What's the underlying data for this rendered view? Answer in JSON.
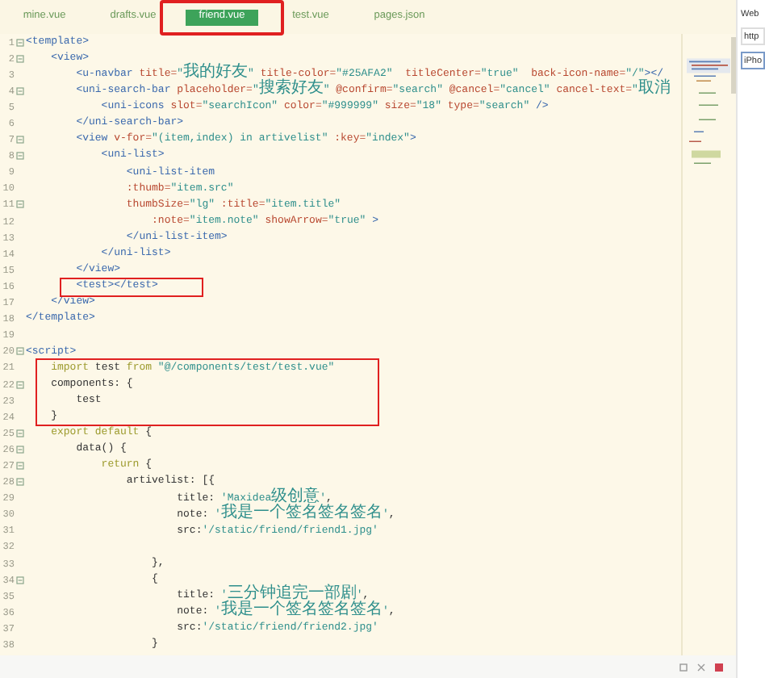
{
  "tabs": [
    {
      "label": "mine.vue",
      "selected": false,
      "boxed": false
    },
    {
      "label": "drafts.vue",
      "selected": false,
      "boxed": false
    },
    {
      "label": "friend.vue",
      "selected": true,
      "boxed": true
    },
    {
      "label": "test.vue",
      "selected": false,
      "boxed": false
    },
    {
      "label": "pages.json",
      "selected": false,
      "boxed": false
    }
  ],
  "lines": [
    {
      "number": "1",
      "foldable": true,
      "boxed": false,
      "tokens": [
        {
          "kind": "tag",
          "text": "<template>"
        }
      ]
    },
    {
      "number": "2",
      "foldable": true,
      "boxed": false,
      "tokens": [
        {
          "kind": "tag",
          "text": "    <view>"
        }
      ]
    },
    {
      "number": "3",
      "foldable": false,
      "boxed": false,
      "tokens": [
        {
          "kind": "tag",
          "text": "        <u-navbar "
        },
        {
          "kind": "attr",
          "text": "title="
        },
        {
          "kind": "str",
          "text": "\"我的好友\""
        },
        {
          "kind": "attr",
          "text": " title-color="
        },
        {
          "kind": "str",
          "text": "\"#25AFA2\""
        },
        {
          "kind": "attr",
          "text": "  titleCenter="
        },
        {
          "kind": "str",
          "text": "\"true\""
        },
        {
          "kind": "attr",
          "text": "  back-icon-name="
        },
        {
          "kind": "str",
          "text": "\"/\""
        },
        {
          "kind": "tag",
          "text": "></"
        }
      ]
    },
    {
      "number": "4",
      "foldable": true,
      "boxed": false,
      "tokens": [
        {
          "kind": "tag",
          "text": "        <uni-search-bar "
        },
        {
          "kind": "attr",
          "text": "placeholder="
        },
        {
          "kind": "str",
          "text": "\"搜索好友\""
        },
        {
          "kind": "attr",
          "text": " @confirm="
        },
        {
          "kind": "str",
          "text": "\"search\""
        },
        {
          "kind": "attr",
          "text": " @cancel="
        },
        {
          "kind": "str",
          "text": "\"cancel\""
        },
        {
          "kind": "attr",
          "text": " cancel-text="
        },
        {
          "kind": "str",
          "text": "\"取消"
        }
      ]
    },
    {
      "number": "5",
      "foldable": false,
      "boxed": false,
      "tokens": [
        {
          "kind": "tag",
          "text": "            <uni-icons "
        },
        {
          "kind": "attr",
          "text": "slot="
        },
        {
          "kind": "str",
          "text": "\"searchIcon\""
        },
        {
          "kind": "attr",
          "text": " color="
        },
        {
          "kind": "str",
          "text": "\"#999999\""
        },
        {
          "kind": "attr",
          "text": " size="
        },
        {
          "kind": "str",
          "text": "\"18\""
        },
        {
          "kind": "attr",
          "text": " type="
        },
        {
          "kind": "str",
          "text": "\"search\""
        },
        {
          "kind": "tag",
          "text": " />"
        }
      ]
    },
    {
      "number": "6",
      "foldable": false,
      "boxed": false,
      "tokens": [
        {
          "kind": "tag",
          "text": "        </uni-search-bar>"
        }
      ]
    },
    {
      "number": "7",
      "foldable": true,
      "boxed": false,
      "tokens": [
        {
          "kind": "tag",
          "text": "        <view "
        },
        {
          "kind": "attr",
          "text": "v-for="
        },
        {
          "kind": "str",
          "text": "\"(item,index) in artivelist\""
        },
        {
          "kind": "attr",
          "text": " :key="
        },
        {
          "kind": "str",
          "text": "\"index\""
        },
        {
          "kind": "tag",
          "text": ">"
        }
      ]
    },
    {
      "number": "8",
      "foldable": true,
      "boxed": false,
      "tokens": [
        {
          "kind": "tag",
          "text": "            <uni-list>"
        }
      ]
    },
    {
      "number": "9",
      "foldable": false,
      "boxed": false,
      "tokens": [
        {
          "kind": "tag",
          "text": "                <uni-list-item"
        }
      ]
    },
    {
      "number": "10",
      "foldable": false,
      "boxed": false,
      "tokens": [
        {
          "kind": "attr",
          "text": "                :thumb="
        },
        {
          "kind": "str",
          "text": "\"item.src\""
        }
      ]
    },
    {
      "number": "11",
      "foldable": true,
      "boxed": false,
      "tokens": [
        {
          "kind": "attr",
          "text": "                thumbSize="
        },
        {
          "kind": "str",
          "text": "\"lg\""
        },
        {
          "kind": "attr",
          "text": " :title="
        },
        {
          "kind": "str",
          "text": "\"item.title\""
        }
      ]
    },
    {
      "number": "12",
      "foldable": false,
      "boxed": false,
      "tokens": [
        {
          "kind": "attr",
          "text": "                    :note="
        },
        {
          "kind": "str",
          "text": "\"item.note\""
        },
        {
          "kind": "attr",
          "text": " showArrow="
        },
        {
          "kind": "str",
          "text": "\"true\""
        },
        {
          "kind": "tag",
          "text": " >"
        }
      ]
    },
    {
      "number": "13",
      "foldable": false,
      "boxed": false,
      "tokens": [
        {
          "kind": "tag",
          "text": "                </uni-list-item>"
        }
      ]
    },
    {
      "number": "14",
      "foldable": false,
      "boxed": false,
      "tokens": [
        {
          "kind": "tag",
          "text": "            </uni-list>"
        }
      ]
    },
    {
      "number": "15",
      "foldable": false,
      "boxed": false,
      "tokens": [
        {
          "kind": "tag",
          "text": "        </view>"
        }
      ]
    },
    {
      "number": "16",
      "foldable": false,
      "boxed": true,
      "tokens": [
        {
          "kind": "tag",
          "text": "        <test></test>"
        }
      ]
    },
    {
      "number": "17",
      "foldable": false,
      "boxed": false,
      "tokens": [
        {
          "kind": "tag",
          "text": "    </view>"
        }
      ]
    },
    {
      "number": "18",
      "foldable": false,
      "boxed": false,
      "tokens": [
        {
          "kind": "tag",
          "text": "</template>"
        }
      ]
    },
    {
      "number": "19",
      "foldable": false,
      "boxed": false
    },
    {
      "number": "20",
      "foldable": true,
      "boxed": false,
      "tokens": [
        {
          "kind": "tag",
          "text": "<script>"
        }
      ]
    },
    {
      "number": "21",
      "foldable": false,
      "boxed": true,
      "tokens": [
        {
          "kind": "kw",
          "text": "    import"
        },
        {
          "kind": "plain",
          "text": " test "
        },
        {
          "kind": "kw",
          "text": "from"
        },
        {
          "kind": "str",
          "text": " \"@/components/test/test.vue\""
        }
      ]
    },
    {
      "number": "22",
      "foldable": true,
      "boxed": true,
      "tokens": [
        {
          "kind": "plain",
          "text": "    components: {"
        }
      ]
    },
    {
      "number": "23",
      "foldable": false,
      "boxed": true,
      "tokens": [
        {
          "kind": "plain",
          "text": "        test"
        }
      ]
    },
    {
      "number": "24",
      "foldable": false,
      "boxed": true,
      "tokens": [
        {
          "kind": "plain",
          "text": "    }"
        }
      ]
    },
    {
      "number": "25",
      "foldable": true,
      "boxed": false,
      "tokens": [
        {
          "kind": "kw",
          "text": "    export default"
        },
        {
          "kind": "plain",
          "text": " {"
        }
      ]
    },
    {
      "number": "26",
      "foldable": true,
      "boxed": false,
      "tokens": [
        {
          "kind": "plain",
          "text": "        data() {"
        }
      ]
    },
    {
      "number": "27",
      "foldable": true,
      "boxed": false,
      "tokens": [
        {
          "kind": "kw",
          "text": "            return"
        },
        {
          "kind": "plain",
          "text": " {"
        }
      ]
    },
    {
      "number": "28",
      "foldable": true,
      "boxed": false,
      "tokens": [
        {
          "kind": "plain",
          "text": "                artivelist: [{"
        }
      ]
    },
    {
      "number": "29",
      "foldable": false,
      "boxed": false,
      "tokens": [
        {
          "kind": "plain",
          "text": "                        title: "
        },
        {
          "kind": "str",
          "text": "'Maxidea级创意'"
        },
        {
          "kind": "plain",
          "text": ","
        }
      ]
    },
    {
      "number": "30",
      "foldable": false,
      "boxed": false,
      "tokens": [
        {
          "kind": "plain",
          "text": "                        note: "
        },
        {
          "kind": "str",
          "text": "'我是一个签名签名签名'"
        },
        {
          "kind": "plain",
          "text": ","
        }
      ]
    },
    {
      "number": "31",
      "foldable": false,
      "boxed": false,
      "tokens": [
        {
          "kind": "plain",
          "text": "                        src:"
        },
        {
          "kind": "str",
          "text": "'/static/friend/friend1.jpg'"
        }
      ]
    },
    {
      "number": "32",
      "foldable": false,
      "boxed": false
    },
    {
      "number": "33",
      "foldable": false,
      "boxed": false,
      "tokens": [
        {
          "kind": "plain",
          "text": "                    },"
        }
      ]
    },
    {
      "number": "34",
      "foldable": true,
      "boxed": false,
      "tokens": [
        {
          "kind": "plain",
          "text": "                    {"
        }
      ]
    },
    {
      "number": "35",
      "foldable": false,
      "boxed": false,
      "tokens": [
        {
          "kind": "plain",
          "text": "                        title: "
        },
        {
          "kind": "str",
          "text": "'三分钟追完一部剧'"
        },
        {
          "kind": "plain",
          "text": ","
        }
      ]
    },
    {
      "number": "36",
      "foldable": false,
      "boxed": false,
      "tokens": [
        {
          "kind": "plain",
          "text": "                        note: "
        },
        {
          "kind": "str",
          "text": "'我是一个签名签名签名'"
        },
        {
          "kind": "plain",
          "text": ","
        }
      ]
    },
    {
      "number": "37",
      "foldable": false,
      "boxed": false,
      "tokens": [
        {
          "kind": "plain",
          "text": "                        src:"
        },
        {
          "kind": "str",
          "text": "'/static/friend/friend2.jpg'"
        }
      ]
    },
    {
      "number": "38",
      "foldable": false,
      "boxed": false,
      "tokens": [
        {
          "kind": "plain",
          "text": "                    }"
        }
      ]
    }
  ],
  "side_panel": {
    "title": "Web",
    "fields": [
      {
        "value": "http",
        "selected": false
      },
      {
        "value": "iPho",
        "selected": true
      }
    ]
  }
}
